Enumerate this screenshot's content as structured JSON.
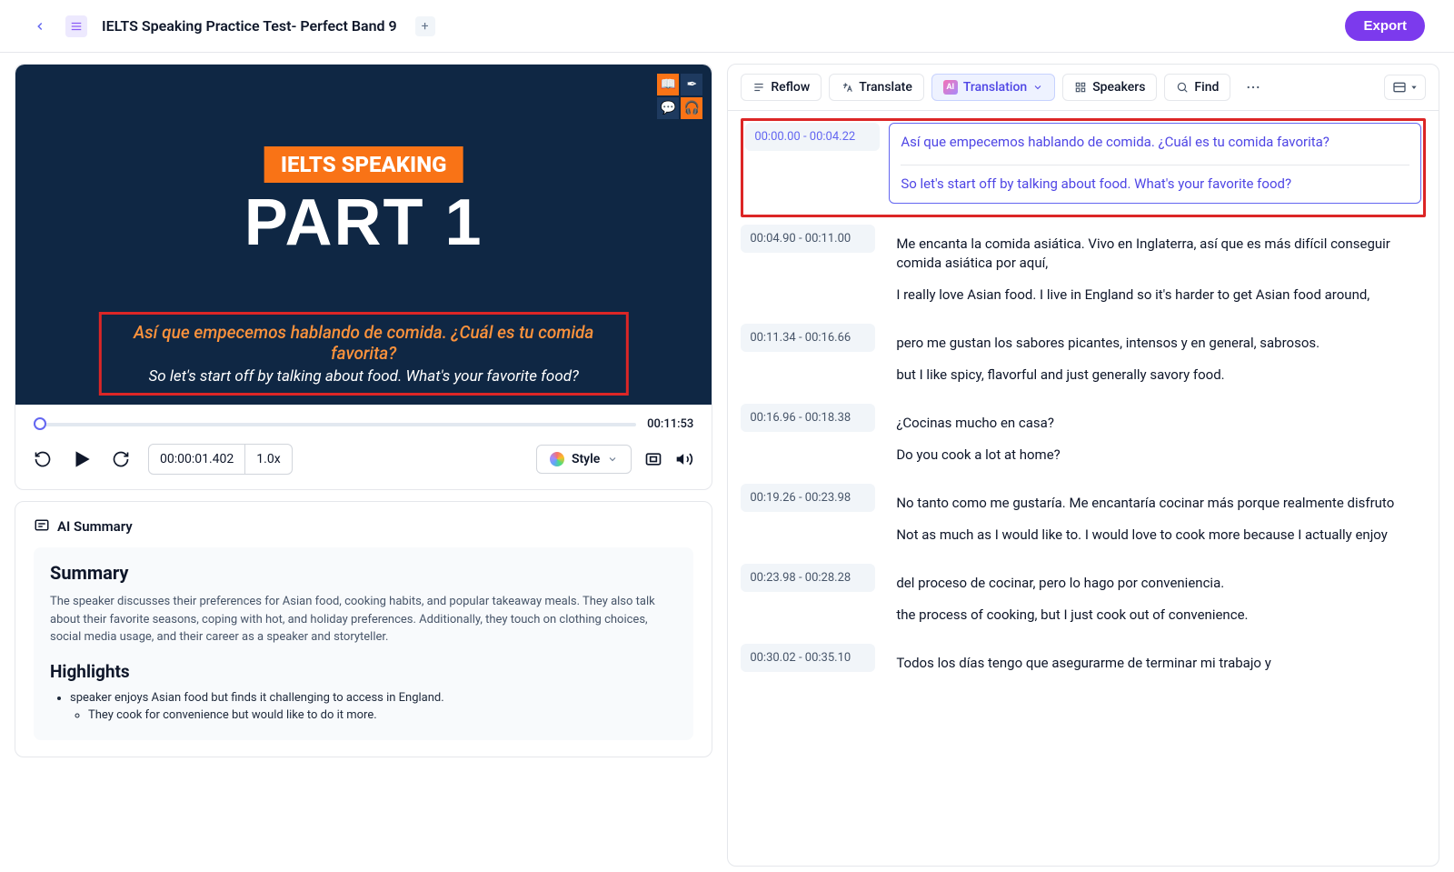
{
  "header": {
    "title": "IELTS Speaking Practice Test- Perfect Band 9",
    "export_label": "Export"
  },
  "video": {
    "badge": "IELTS SPEAKING",
    "part": "PART 1",
    "caption_es": "Así que empecemos hablando de comida. ¿Cuál es tu comida favorita?",
    "caption_en": "So let's start off by talking about food. What's your favorite food?",
    "duration": "00:11:53",
    "current_time": "00:00:01.402",
    "speed": "1.0x",
    "style_label": "Style"
  },
  "summary": {
    "header": "AI Summary",
    "title": "Summary",
    "body": "The speaker discusses their preferences for Asian food, cooking habits, and popular takeaway meals. They also talk about their favorite seasons, coping with hot, and holiday preferences. Additionally, they touch on clothing choices, social media usage, and their career as a speaker and storyteller.",
    "highlights_title": "Highlights",
    "highlights": [
      "speaker enjoys Asian food but finds it challenging to access in England.",
      "They cook for convenience but would like to do it more."
    ]
  },
  "toolbar": {
    "reflow": "Reflow",
    "translate": "Translate",
    "translation": "Translation",
    "speakers": "Speakers",
    "find": "Find"
  },
  "segments": [
    {
      "time": "00:00.00 - 00:04.22",
      "es": "Así que empecemos hablando de comida. ¿Cuál es tu comida favorita?",
      "en": "So let's start off by talking about food. What's your favorite food?",
      "selected": true
    },
    {
      "time": "00:04.90 - 00:11.00",
      "es": "Me encanta la comida asiática. Vivo en Inglaterra, así que es más difícil conseguir comida asiática por aquí,",
      "en": "I really love Asian food. I live in England so it's harder to get Asian food around,"
    },
    {
      "time": "00:11.34  -  00:16.66",
      "es": "pero me gustan los sabores picantes, intensos y en general, sabrosos.",
      "en": "but I like spicy, flavorful and just generally savory food."
    },
    {
      "time": "00:16.96  -  00:18.38",
      "es": "¿Cocinas mucho en casa?",
      "en": "Do you cook a lot at home?"
    },
    {
      "time": "00:19.26  -  00:23.98",
      "es": "No tanto como me gustaría. Me encantaría cocinar más porque realmente disfruto",
      "en": "Not as much as I would like to. I would love to cook more because I actually enjoy"
    },
    {
      "time": "00:23.98  -  00:28.28",
      "es": "del proceso de cocinar, pero lo hago por conveniencia.",
      "en": "the process of cooking, but I just cook out of convenience."
    },
    {
      "time": "00:30.02  -  00:35.10",
      "es": "Todos los días tengo que asegurarme de terminar mi trabajo y",
      "en": ""
    }
  ]
}
